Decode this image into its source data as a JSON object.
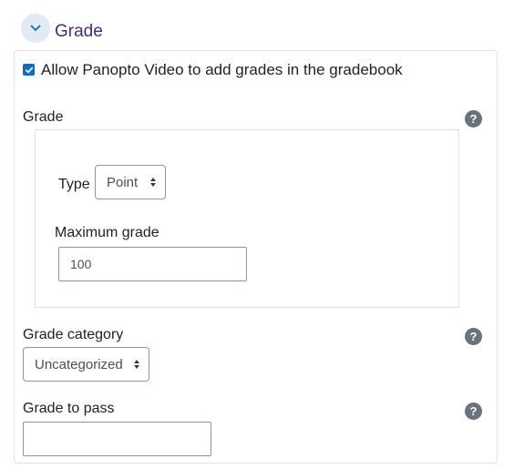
{
  "section": {
    "title": "Grade",
    "expanded": true
  },
  "allow_grades": {
    "label": "Allow Panopto Video to add grades in the gradebook",
    "checked": true
  },
  "grade": {
    "label": "Grade",
    "help": "?",
    "type_label": "Type",
    "type_value": "Point",
    "max_label": "Maximum grade",
    "max_value": "100"
  },
  "grade_category": {
    "label": "Grade category",
    "help": "?",
    "value": "Uncategorized"
  },
  "grade_to_pass": {
    "label": "Grade to pass",
    "help": "?",
    "value": ""
  },
  "colors": {
    "accent": "#0f6cbf",
    "title": "#4b2a78",
    "help_bg": "#6a737b"
  }
}
